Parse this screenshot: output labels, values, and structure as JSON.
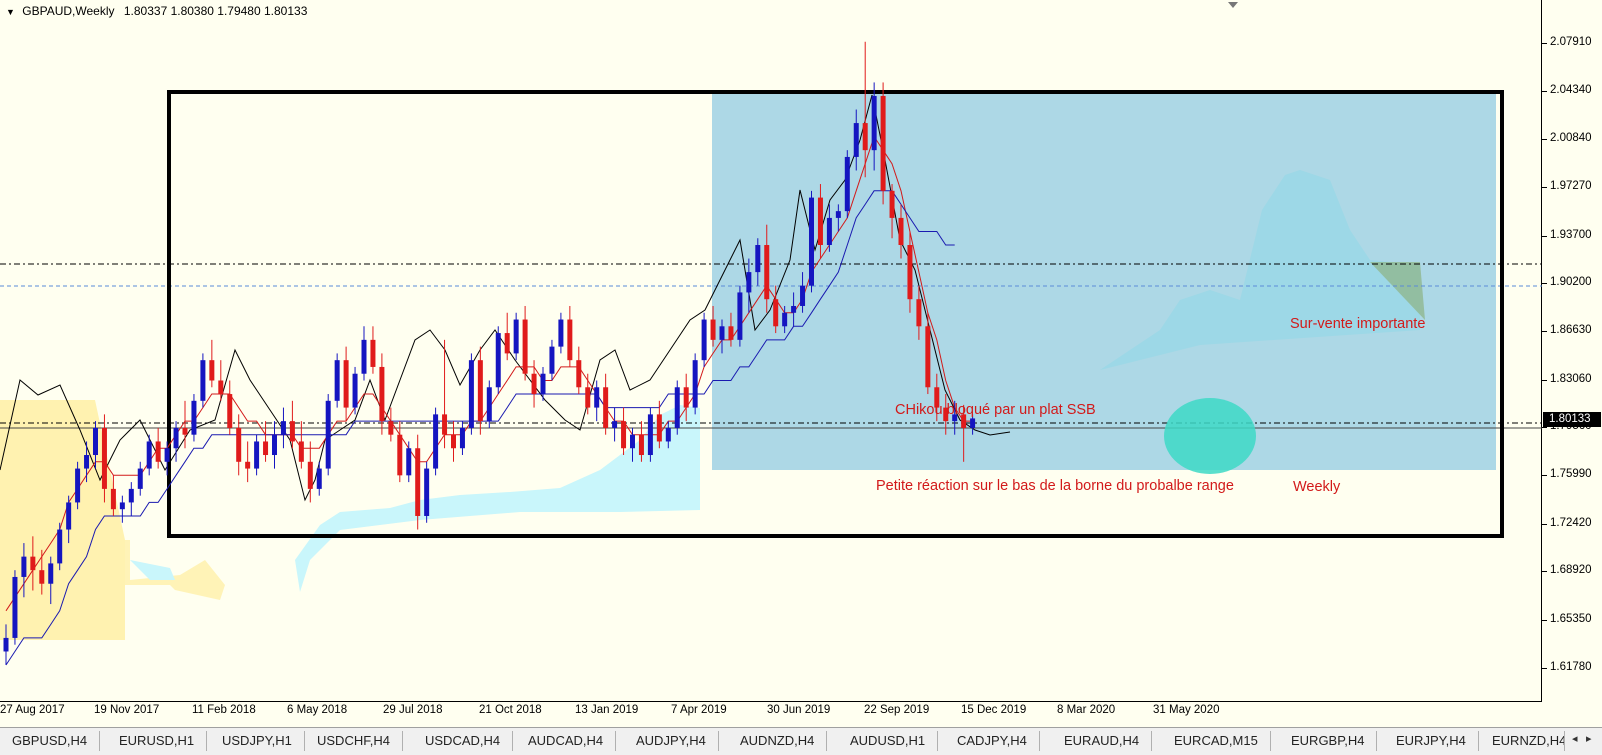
{
  "header": {
    "symbol": "GBPAUD,Weekly",
    "ohlc": "1.80337 1.80380 1.79480 1.80133"
  },
  "price_axis": {
    "labels": [
      "2.07910",
      "2.04340",
      "2.00840",
      "1.97270",
      "1.93700",
      "1.90200",
      "1.86630",
      "1.83060",
      "1.79560",
      "1.75990",
      "1.72420",
      "1.68920",
      "1.65350",
      "1.61780"
    ],
    "current_price": "1.80133"
  },
  "time_axis": {
    "labels": [
      "27 Aug 2017",
      "19 Nov 2017",
      "11 Feb 2018",
      "6 May 2018",
      "29 Jul 2018",
      "21 Oct 2018",
      "13 Jan 2019",
      "7 Apr 2019",
      "30 Jun 2019",
      "22 Sep 2019",
      "15 Dec 2019",
      "8 Mar 2020",
      "31 May 2020"
    ]
  },
  "annotations": {
    "chikou": "CHikou bloqué par un plat SSB",
    "sur_vente": "Sur-vente importante",
    "petite_reaction": "Petite réaction sur le bas de la borne du probalbe range",
    "weekly": "Weekly"
  },
  "colors": {
    "bull_candle": "#1515c0",
    "bear_candle": "#e01b1b",
    "tenkan": "#d21a1a",
    "kijun": "#1a1ab0",
    "chikou": "#000000",
    "kumo_bear": "#fff2b0",
    "kumo_bull": "#c9f6fb",
    "range_box": "#add8e6",
    "highlight_circle": "#3dd9c5"
  },
  "symbol_tabs": [
    "GBPUSD,H4",
    "EURUSD,H1",
    "USDJPY,H1",
    "USDCHF,H4",
    "USDCAD,H4",
    "AUDCAD,H4",
    "AUDJPY,H4",
    "AUDNZD,H4",
    "AUDUSD,H1",
    "CADJPY,H4",
    "EURAUD,H4",
    "EURCAD,M15",
    "EURGBP,H4",
    "EURJPY,H4",
    "EURNZD,H4"
  ],
  "tab_nav": {
    "left": "◂",
    "right": "▸"
  },
  "chart_data": {
    "type": "candlestick",
    "title": "GBPAUD,Weekly",
    "ylim": [
      1.6,
      2.1
    ],
    "x_start_label": "27 Aug 2017",
    "candles_ohlc": [
      [
        1.63,
        1.65,
        1.62,
        1.64
      ],
      [
        1.64,
        1.69,
        1.635,
        1.685
      ],
      [
        1.685,
        1.71,
        1.67,
        1.7
      ],
      [
        1.7,
        1.715,
        1.675,
        1.69
      ],
      [
        1.69,
        1.705,
        1.672,
        1.68
      ],
      [
        1.68,
        1.7,
        1.665,
        1.695
      ],
      [
        1.695,
        1.725,
        1.69,
        1.72
      ],
      [
        1.72,
        1.745,
        1.71,
        1.74
      ],
      [
        1.74,
        1.77,
        1.735,
        1.765
      ],
      [
        1.765,
        1.785,
        1.755,
        1.775
      ],
      [
        1.775,
        1.8,
        1.765,
        1.795
      ],
      [
        1.795,
        1.805,
        1.74,
        1.75
      ],
      [
        1.75,
        1.76,
        1.73,
        1.735
      ],
      [
        1.735,
        1.745,
        1.725,
        1.74
      ],
      [
        1.74,
        1.755,
        1.73,
        1.75
      ],
      [
        1.75,
        1.77,
        1.745,
        1.765
      ],
      [
        1.765,
        1.79,
        1.76,
        1.785
      ],
      [
        1.785,
        1.795,
        1.765,
        1.77
      ],
      [
        1.77,
        1.785,
        1.76,
        1.78
      ],
      [
        1.78,
        1.8,
        1.77,
        1.795
      ],
      [
        1.795,
        1.815,
        1.78,
        1.79
      ],
      [
        1.79,
        1.82,
        1.785,
        1.815
      ],
      [
        1.815,
        1.85,
        1.81,
        1.845
      ],
      [
        1.845,
        1.86,
        1.825,
        1.83
      ],
      [
        1.83,
        1.845,
        1.815,
        1.82
      ],
      [
        1.82,
        1.83,
        1.79,
        1.795
      ],
      [
        1.795,
        1.805,
        1.76,
        1.77
      ],
      [
        1.77,
        1.785,
        1.755,
        1.765
      ],
      [
        1.765,
        1.79,
        1.76,
        1.785
      ],
      [
        1.785,
        1.8,
        1.77,
        1.775
      ],
      [
        1.775,
        1.8,
        1.765,
        1.79
      ],
      [
        1.79,
        1.81,
        1.78,
        1.8
      ],
      [
        1.8,
        1.815,
        1.78,
        1.785
      ],
      [
        1.785,
        1.8,
        1.765,
        1.77
      ],
      [
        1.77,
        1.785,
        1.74,
        1.75
      ],
      [
        1.75,
        1.77,
        1.745,
        1.765
      ],
      [
        1.765,
        1.82,
        1.76,
        1.815
      ],
      [
        1.815,
        1.85,
        1.81,
        1.845
      ],
      [
        1.845,
        1.855,
        1.8,
        1.81
      ],
      [
        1.81,
        1.84,
        1.805,
        1.835
      ],
      [
        1.835,
        1.87,
        1.83,
        1.86
      ],
      [
        1.86,
        1.87,
        1.835,
        1.84
      ],
      [
        1.84,
        1.85,
        1.79,
        1.8
      ],
      [
        1.8,
        1.81,
        1.785,
        1.79
      ],
      [
        1.79,
        1.8,
        1.755,
        1.76
      ],
      [
        1.76,
        1.785,
        1.755,
        1.78
      ],
      [
        1.78,
        1.79,
        1.72,
        1.73
      ],
      [
        1.73,
        1.77,
        1.725,
        1.765
      ],
      [
        1.765,
        1.81,
        1.76,
        1.805
      ],
      [
        1.805,
        1.86,
        1.78,
        1.79
      ],
      [
        1.79,
        1.8,
        1.77,
        1.78
      ],
      [
        1.78,
        1.8,
        1.775,
        1.795
      ],
      [
        1.795,
        1.85,
        1.79,
        1.845
      ],
      [
        1.845,
        1.855,
        1.79,
        1.8
      ],
      [
        1.8,
        1.83,
        1.795,
        1.825
      ],
      [
        1.825,
        1.87,
        1.82,
        1.865
      ],
      [
        1.865,
        1.88,
        1.845,
        1.85
      ],
      [
        1.85,
        1.88,
        1.845,
        1.875
      ],
      [
        1.875,
        1.885,
        1.83,
        1.835
      ],
      [
        1.835,
        1.845,
        1.81,
        1.82
      ],
      [
        1.82,
        1.84,
        1.815,
        1.835
      ],
      [
        1.835,
        1.86,
        1.83,
        1.855
      ],
      [
        1.855,
        1.88,
        1.85,
        1.875
      ],
      [
        1.875,
        1.885,
        1.84,
        1.845
      ],
      [
        1.845,
        1.855,
        1.82,
        1.825
      ],
      [
        1.825,
        1.835,
        1.805,
        1.81
      ],
      [
        1.81,
        1.83,
        1.8,
        1.825
      ],
      [
        1.825,
        1.835,
        1.79,
        1.795
      ],
      [
        1.795,
        1.81,
        1.785,
        1.8
      ],
      [
        1.8,
        1.81,
        1.775,
        1.78
      ],
      [
        1.78,
        1.795,
        1.77,
        1.79
      ],
      [
        1.79,
        1.8,
        1.77,
        1.775
      ],
      [
        1.775,
        1.81,
        1.77,
        1.805
      ],
      [
        1.805,
        1.815,
        1.78,
        1.785
      ],
      [
        1.785,
        1.8,
        1.78,
        1.795
      ],
      [
        1.795,
        1.83,
        1.79,
        1.825
      ],
      [
        1.825,
        1.835,
        1.8,
        1.81
      ],
      [
        1.81,
        1.85,
        1.805,
        1.845
      ],
      [
        1.845,
        1.88,
        1.84,
        1.875
      ],
      [
        1.875,
        1.885,
        1.855,
        1.86
      ],
      [
        1.86,
        1.875,
        1.85,
        1.87
      ],
      [
        1.87,
        1.88,
        1.855,
        1.86
      ],
      [
        1.86,
        1.9,
        1.855,
        1.895
      ],
      [
        1.895,
        1.92,
        1.88,
        1.91
      ],
      [
        1.91,
        1.935,
        1.9,
        1.93
      ],
      [
        1.93,
        1.945,
        1.88,
        1.89
      ],
      [
        1.89,
        1.9,
        1.865,
        1.87
      ],
      [
        1.87,
        1.885,
        1.865,
        1.88
      ],
      [
        1.88,
        1.895,
        1.87,
        1.885
      ],
      [
        1.885,
        1.91,
        1.88,
        1.9
      ],
      [
        1.9,
        1.97,
        1.895,
        1.965
      ],
      [
        1.965,
        1.975,
        1.92,
        1.93
      ],
      [
        1.93,
        1.96,
        1.925,
        1.95
      ],
      [
        1.95,
        1.96,
        1.94,
        1.955
      ],
      [
        1.955,
        2.0,
        1.95,
        1.995
      ],
      [
        1.995,
        2.03,
        1.985,
        2.02
      ],
      [
        2.02,
        2.08,
        1.98,
        2.0
      ],
      [
        2.0,
        2.05,
        1.985,
        2.04
      ],
      [
        2.04,
        2.05,
        1.96,
        1.97
      ],
      [
        1.97,
        1.975,
        1.935,
        1.95
      ],
      [
        1.95,
        1.96,
        1.92,
        1.93
      ],
      [
        1.93,
        1.94,
        1.88,
        1.89
      ],
      [
        1.89,
        1.9,
        1.86,
        1.87
      ],
      [
        1.87,
        1.88,
        1.82,
        1.825
      ],
      [
        1.825,
        1.835,
        1.8,
        1.81
      ],
      [
        1.81,
        1.82,
        1.79,
        1.8
      ],
      [
        1.8,
        1.815,
        1.79,
        1.805
      ],
      [
        1.805,
        1.812,
        1.77,
        1.795
      ],
      [
        1.795,
        1.805,
        1.79,
        1.802
      ]
    ],
    "candle_x_positions_note": "weekly",
    "tenkan": [
      1.66,
      1.67,
      1.68,
      1.69,
      1.7,
      1.71,
      1.72,
      1.74,
      1.75,
      1.76,
      1.77,
      1.77,
      1.76,
      1.76,
      1.76,
      1.76,
      1.77,
      1.78,
      1.78,
      1.79,
      1.8,
      1.8,
      1.81,
      1.82,
      1.82,
      1.82,
      1.81,
      1.8,
      1.8,
      1.79,
      1.79,
      1.79,
      1.79,
      1.78,
      1.78,
      1.78,
      1.79,
      1.8,
      1.8,
      1.81,
      1.82,
      1.82,
      1.81,
      1.8,
      1.79,
      1.78,
      1.77,
      1.77,
      1.78,
      1.79,
      1.79,
      1.79,
      1.8,
      1.8,
      1.81,
      1.82,
      1.83,
      1.84,
      1.84,
      1.84,
      1.83,
      1.83,
      1.84,
      1.84,
      1.84,
      1.83,
      1.82,
      1.81,
      1.8,
      1.8,
      1.79,
      1.79,
      1.79,
      1.79,
      1.8,
      1.8,
      1.81,
      1.82,
      1.84,
      1.85,
      1.86,
      1.86,
      1.87,
      1.88,
      1.89,
      1.9,
      1.89,
      1.88,
      1.88,
      1.89,
      1.91,
      1.92,
      1.93,
      1.94,
      1.95,
      1.97,
      1.99,
      2.01,
      2.0,
      1.99,
      1.97,
      1.94,
      1.91,
      1.88,
      1.86,
      1.83,
      1.81,
      1.8,
      1.8
    ],
    "kijun": [
      1.62,
      1.63,
      1.64,
      1.64,
      1.64,
      1.65,
      1.66,
      1.68,
      1.69,
      1.7,
      1.72,
      1.73,
      1.73,
      1.73,
      1.73,
      1.73,
      1.74,
      1.74,
      1.75,
      1.76,
      1.77,
      1.78,
      1.78,
      1.79,
      1.79,
      1.79,
      1.79,
      1.79,
      1.79,
      1.79,
      1.79,
      1.79,
      1.79,
      1.79,
      1.79,
      1.79,
      1.79,
      1.79,
      1.79,
      1.8,
      1.8,
      1.8,
      1.8,
      1.8,
      1.8,
      1.8,
      1.8,
      1.8,
      1.8,
      1.8,
      1.8,
      1.8,
      1.8,
      1.8,
      1.8,
      1.8,
      1.81,
      1.82,
      1.82,
      1.82,
      1.82,
      1.82,
      1.82,
      1.82,
      1.82,
      1.82,
      1.82,
      1.81,
      1.81,
      1.81,
      1.81,
      1.81,
      1.81,
      1.81,
      1.82,
      1.82,
      1.82,
      1.82,
      1.82,
      1.83,
      1.83,
      1.83,
      1.84,
      1.84,
      1.85,
      1.86,
      1.86,
      1.86,
      1.87,
      1.87,
      1.88,
      1.89,
      1.9,
      1.91,
      1.93,
      1.95,
      1.96,
      1.97,
      1.97,
      1.97,
      1.96,
      1.95,
      1.94,
      1.94,
      1.94,
      1.93,
      1.93
    ]
  }
}
